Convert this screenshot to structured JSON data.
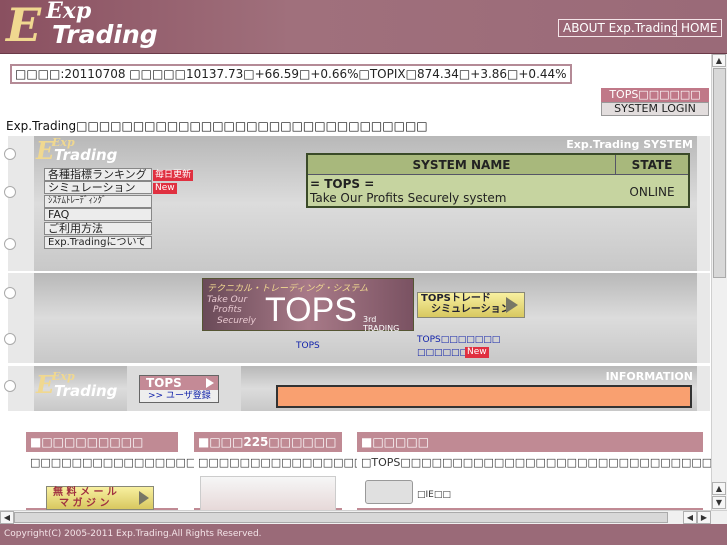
{
  "header": {
    "logo_exp": "Exp",
    "logo_e": "E",
    "logo_trading": "Trading",
    "nav": [
      "ABOUT Exp.Trading",
      "HOME"
    ]
  },
  "ticker": {
    "text": "□□□□:20110708 □□□□□10137.73□+66.59□+0.66%□TOPIX□874.34□+3.86□+0.44%"
  },
  "top_links": {
    "tops": "TOPS□□□□□□",
    "login": "SYSTEM LOGIN"
  },
  "intro": "Exp.Trading□□□□□□□□□□□□□□□□□□□□□□□□□□□□□□□",
  "system_panel": {
    "title": "Exp.Trading SYSTEM",
    "menu": [
      {
        "label": "各種指標ランキング",
        "badge": "毎日更新"
      },
      {
        "label": "シミュレーション",
        "badge": "New"
      },
      {
        "label": "ｼｽﾃﾑﾄﾚｰﾃﾞｨﾝｸﾞ",
        "badge": ""
      },
      {
        "label": "FAQ",
        "badge": ""
      },
      {
        "label": "ご利用方法",
        "badge": ""
      },
      {
        "label": "Exp.Tradingについて",
        "badge": ""
      }
    ],
    "table": {
      "col_name": "SYSTEM NAME",
      "col_state": "STATE",
      "row_name_1": "= TOPS =",
      "row_name_2": "Take Our Profits Securely system",
      "row_state": "ONLINE"
    }
  },
  "tops_panel": {
    "banner_top": "テクニカル・トレーディング・システム",
    "banner_main": "TOPS",
    "banner_sub1": "Take Our",
    "banner_sub2": "Profits",
    "banner_sub3": "Securely",
    "banner_badge": "3rd TRADING",
    "caption": "TOPS",
    "btn_line1": "TOPSトレード",
    "btn_line2": "シミュレーション",
    "link_1": "TOPS□□□□□□□",
    "link_2": "□□□□□□□□",
    "link_badge": "New"
  },
  "info_panel": {
    "title": "INFORMATION",
    "register_tops": "TOPS",
    "register_label": ">> ユーザ登録"
  },
  "boxes": [
    {
      "title": "■□□□□□□□□□",
      "body": "□□□□□□□□□□□□□□□□□□□□□□□□",
      "button_line1": "無 料 メ ー ル",
      "button_line2": "マ ガ ジ ン"
    },
    {
      "title": "■□□□225□□□□□□",
      "body": "□□□□□□□□□□□□□□□□□□□"
    },
    {
      "title": "■□□□□□",
      "body": "□TOPS□□□□□□□□□□□□□□□□□□□□□□□□□□□□□□□□",
      "body2": "□IE□□"
    }
  ],
  "footer": "Copyright(C) 2005-2011 Exp.Trading.All Rights Reserved.",
  "colors": {
    "header": "#9a6a78",
    "accent": "#c07888",
    "table_bg": "#c6d4a0",
    "info_bar": "#f9a070"
  }
}
